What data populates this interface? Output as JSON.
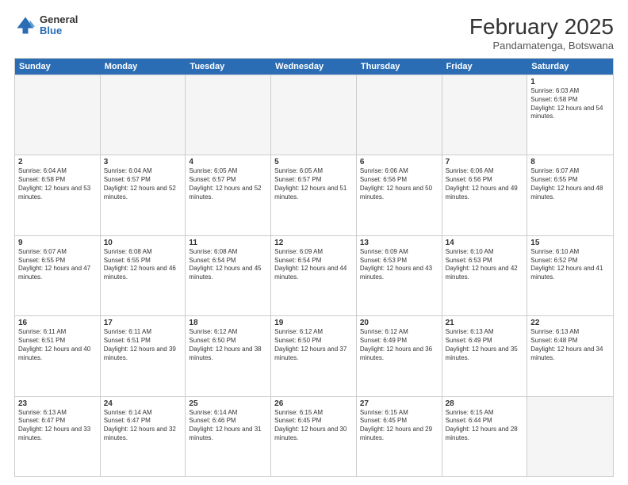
{
  "header": {
    "logo": {
      "general": "General",
      "blue": "Blue"
    },
    "title": "February 2025",
    "subtitle": "Pandamatenga, Botswana"
  },
  "calendar": {
    "days_of_week": [
      "Sunday",
      "Monday",
      "Tuesday",
      "Wednesday",
      "Thursday",
      "Friday",
      "Saturday"
    ],
    "rows": [
      [
        {
          "day": "",
          "empty": true
        },
        {
          "day": "",
          "empty": true
        },
        {
          "day": "",
          "empty": true
        },
        {
          "day": "",
          "empty": true
        },
        {
          "day": "",
          "empty": true
        },
        {
          "day": "",
          "empty": true
        },
        {
          "day": "1",
          "sunrise": "Sunrise: 6:03 AM",
          "sunset": "Sunset: 6:58 PM",
          "daylight": "Daylight: 12 hours and 54 minutes."
        }
      ],
      [
        {
          "day": "2",
          "sunrise": "Sunrise: 6:04 AM",
          "sunset": "Sunset: 6:58 PM",
          "daylight": "Daylight: 12 hours and 53 minutes."
        },
        {
          "day": "3",
          "sunrise": "Sunrise: 6:04 AM",
          "sunset": "Sunset: 6:57 PM",
          "daylight": "Daylight: 12 hours and 52 minutes."
        },
        {
          "day": "4",
          "sunrise": "Sunrise: 6:05 AM",
          "sunset": "Sunset: 6:57 PM",
          "daylight": "Daylight: 12 hours and 52 minutes."
        },
        {
          "day": "5",
          "sunrise": "Sunrise: 6:05 AM",
          "sunset": "Sunset: 6:57 PM",
          "daylight": "Daylight: 12 hours and 51 minutes."
        },
        {
          "day": "6",
          "sunrise": "Sunrise: 6:06 AM",
          "sunset": "Sunset: 6:56 PM",
          "daylight": "Daylight: 12 hours and 50 minutes."
        },
        {
          "day": "7",
          "sunrise": "Sunrise: 6:06 AM",
          "sunset": "Sunset: 6:56 PM",
          "daylight": "Daylight: 12 hours and 49 minutes."
        },
        {
          "day": "8",
          "sunrise": "Sunrise: 6:07 AM",
          "sunset": "Sunset: 6:55 PM",
          "daylight": "Daylight: 12 hours and 48 minutes."
        }
      ],
      [
        {
          "day": "9",
          "sunrise": "Sunrise: 6:07 AM",
          "sunset": "Sunset: 6:55 PM",
          "daylight": "Daylight: 12 hours and 47 minutes."
        },
        {
          "day": "10",
          "sunrise": "Sunrise: 6:08 AM",
          "sunset": "Sunset: 6:55 PM",
          "daylight": "Daylight: 12 hours and 46 minutes."
        },
        {
          "day": "11",
          "sunrise": "Sunrise: 6:08 AM",
          "sunset": "Sunset: 6:54 PM",
          "daylight": "Daylight: 12 hours and 45 minutes."
        },
        {
          "day": "12",
          "sunrise": "Sunrise: 6:09 AM",
          "sunset": "Sunset: 6:54 PM",
          "daylight": "Daylight: 12 hours and 44 minutes."
        },
        {
          "day": "13",
          "sunrise": "Sunrise: 6:09 AM",
          "sunset": "Sunset: 6:53 PM",
          "daylight": "Daylight: 12 hours and 43 minutes."
        },
        {
          "day": "14",
          "sunrise": "Sunrise: 6:10 AM",
          "sunset": "Sunset: 6:53 PM",
          "daylight": "Daylight: 12 hours and 42 minutes."
        },
        {
          "day": "15",
          "sunrise": "Sunrise: 6:10 AM",
          "sunset": "Sunset: 6:52 PM",
          "daylight": "Daylight: 12 hours and 41 minutes."
        }
      ],
      [
        {
          "day": "16",
          "sunrise": "Sunrise: 6:11 AM",
          "sunset": "Sunset: 6:51 PM",
          "daylight": "Daylight: 12 hours and 40 minutes."
        },
        {
          "day": "17",
          "sunrise": "Sunrise: 6:11 AM",
          "sunset": "Sunset: 6:51 PM",
          "daylight": "Daylight: 12 hours and 39 minutes."
        },
        {
          "day": "18",
          "sunrise": "Sunrise: 6:12 AM",
          "sunset": "Sunset: 6:50 PM",
          "daylight": "Daylight: 12 hours and 38 minutes."
        },
        {
          "day": "19",
          "sunrise": "Sunrise: 6:12 AM",
          "sunset": "Sunset: 6:50 PM",
          "daylight": "Daylight: 12 hours and 37 minutes."
        },
        {
          "day": "20",
          "sunrise": "Sunrise: 6:12 AM",
          "sunset": "Sunset: 6:49 PM",
          "daylight": "Daylight: 12 hours and 36 minutes."
        },
        {
          "day": "21",
          "sunrise": "Sunrise: 6:13 AM",
          "sunset": "Sunset: 6:49 PM",
          "daylight": "Daylight: 12 hours and 35 minutes."
        },
        {
          "day": "22",
          "sunrise": "Sunrise: 6:13 AM",
          "sunset": "Sunset: 6:48 PM",
          "daylight": "Daylight: 12 hours and 34 minutes."
        }
      ],
      [
        {
          "day": "23",
          "sunrise": "Sunrise: 6:13 AM",
          "sunset": "Sunset: 6:47 PM",
          "daylight": "Daylight: 12 hours and 33 minutes."
        },
        {
          "day": "24",
          "sunrise": "Sunrise: 6:14 AM",
          "sunset": "Sunset: 6:47 PM",
          "daylight": "Daylight: 12 hours and 32 minutes."
        },
        {
          "day": "25",
          "sunrise": "Sunrise: 6:14 AM",
          "sunset": "Sunset: 6:46 PM",
          "daylight": "Daylight: 12 hours and 31 minutes."
        },
        {
          "day": "26",
          "sunrise": "Sunrise: 6:15 AM",
          "sunset": "Sunset: 6:45 PM",
          "daylight": "Daylight: 12 hours and 30 minutes."
        },
        {
          "day": "27",
          "sunrise": "Sunrise: 6:15 AM",
          "sunset": "Sunset: 6:45 PM",
          "daylight": "Daylight: 12 hours and 29 minutes."
        },
        {
          "day": "28",
          "sunrise": "Sunrise: 6:15 AM",
          "sunset": "Sunset: 6:44 PM",
          "daylight": "Daylight: 12 hours and 28 minutes."
        },
        {
          "day": "",
          "empty": true
        }
      ]
    ]
  }
}
